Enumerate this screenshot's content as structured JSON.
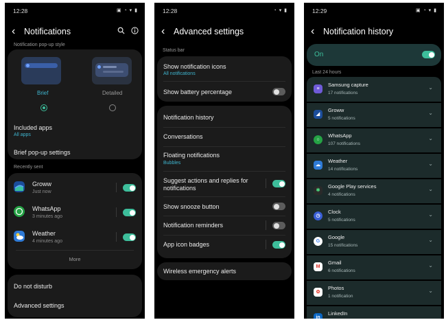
{
  "colors": {
    "accent": "#3dbe9b",
    "link": "#3fb6d0",
    "card": "#1b1b1b",
    "history_card": "#1c2b2b"
  },
  "screen1": {
    "status_time": "12:28",
    "title": "Notifications",
    "section_popup": "Notification pop-up style",
    "style_brief": "Brief",
    "style_detailed": "Detailed",
    "included_apps": "Included apps",
    "included_apps_sub": "All apps",
    "brief_settings": "Brief pop-up settings",
    "recently_sent": "Recently sent",
    "apps": [
      {
        "name": "Groww",
        "time": "Just now",
        "icon": "groww-icon",
        "enabled": true
      },
      {
        "name": "WhatsApp",
        "time": "3 minutes ago",
        "icon": "whatsapp-icon",
        "enabled": true
      },
      {
        "name": "Weather",
        "time": "4 minutes ago",
        "icon": "weather-icon",
        "enabled": true
      }
    ],
    "more": "More",
    "do_not_disturb": "Do not disturb",
    "advanced": "Advanced settings"
  },
  "screen2": {
    "status_time": "12:28",
    "title": "Advanced settings",
    "status_bar_label": "Status bar",
    "show_icons": "Show notification icons",
    "show_icons_sub": "All notifications",
    "battery": "Show battery percentage",
    "history": "Notification history",
    "conversations": "Conversations",
    "floating": "Floating notifications",
    "floating_sub": "Bubbles",
    "suggest_line1": "Suggest actions and replies for",
    "suggest_line2": "notifications",
    "snooze": "Show snooze button",
    "reminders": "Notification reminders",
    "badges": "App icon badges",
    "emergency": "Wireless emergency alerts"
  },
  "screen3": {
    "status_time": "12:29",
    "title": "Notification history",
    "on_label": "On",
    "last24": "Last 24 hours",
    "items": [
      {
        "name": "Samsung capture",
        "count": "17 notifications",
        "icon": "samsung-capture-icon"
      },
      {
        "name": "Groww",
        "count": "5 notifications",
        "icon": "groww-icon"
      },
      {
        "name": "WhatsApp",
        "count": "107 notifications",
        "icon": "whatsapp-icon"
      },
      {
        "name": "Weather",
        "count": "14 notifications",
        "icon": "weather-icon"
      },
      {
        "name": "Google Play services",
        "count": "4 notifications",
        "icon": "google-play-services-icon"
      },
      {
        "name": "Clock",
        "count": "5 notifications",
        "icon": "clock-icon"
      },
      {
        "name": "Google",
        "count": "15 notifications",
        "icon": "google-icon"
      },
      {
        "name": "Gmail",
        "count": "6 notifications",
        "icon": "gmail-icon"
      },
      {
        "name": "Photos",
        "count": "1 notification",
        "icon": "photos-icon"
      },
      {
        "name": "LinkedIn",
        "count": "",
        "icon": "linkedin-icon"
      }
    ]
  }
}
